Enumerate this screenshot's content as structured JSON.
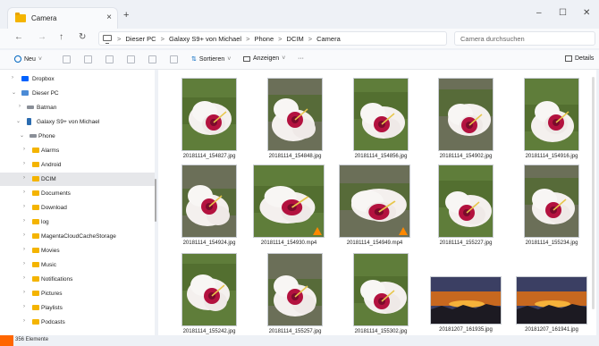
{
  "tab": {
    "title": "Camera",
    "close": "×",
    "new": "+"
  },
  "window": {
    "minimize": "–",
    "maximize": "☐",
    "close": "✕"
  },
  "nav": {
    "back": "←",
    "forward": "→",
    "up": "↑",
    "refresh": "↻",
    "more": "›"
  },
  "breadcrumbs": [
    "Dieser PC",
    "Galaxy S9+ von Michael",
    "Phone",
    "DCIM",
    "Camera"
  ],
  "breadcrumb_sep": ">",
  "search": {
    "placeholder": "Camera durchsuchen"
  },
  "toolbar": {
    "new_label": "Neu",
    "sort_label": "Sortieren",
    "view_label": "Anzeigen",
    "more_label": "···",
    "details_label": "Details"
  },
  "sidebar": {
    "items": [
      {
        "label": "Dropbox",
        "chev": ">",
        "icon": "dropbox-icon"
      },
      {
        "label": "Dieser PC",
        "chev": "v",
        "icon": "pc-icon"
      },
      {
        "label": "Batman",
        "chev": ">",
        "icon": "drive-icon"
      },
      {
        "label": "Galaxy S9+ von Michael",
        "chev": "v",
        "icon": "phone-icon"
      },
      {
        "label": "Phone",
        "chev": "v",
        "icon": "drive-icon"
      },
      {
        "label": "Alarms",
        "chev": ">",
        "icon": "folder-icon"
      },
      {
        "label": "Android",
        "chev": ">",
        "icon": "folder-icon"
      },
      {
        "label": "DCIM",
        "chev": ">",
        "icon": "folder-icon",
        "selected": true
      },
      {
        "label": "Documents",
        "chev": ">",
        "icon": "folder-icon"
      },
      {
        "label": "Download",
        "chev": ">",
        "icon": "folder-icon"
      },
      {
        "label": "log",
        "chev": ">",
        "icon": "folder-icon"
      },
      {
        "label": "MagentaCloudCacheStorage",
        "chev": ">",
        "icon": "folder-icon"
      },
      {
        "label": "Movies",
        "chev": ">",
        "icon": "folder-icon"
      },
      {
        "label": "Music",
        "chev": ">",
        "icon": "folder-icon"
      },
      {
        "label": "Notifications",
        "chev": ">",
        "icon": "folder-icon"
      },
      {
        "label": "Pictures",
        "chev": ">",
        "icon": "folder-icon"
      },
      {
        "label": "Playlists",
        "chev": ">",
        "icon": "folder-icon"
      },
      {
        "label": "Podcasts",
        "chev": ">",
        "icon": "folder-icon"
      }
    ]
  },
  "files": [
    {
      "name": "20181114_154827.jpg",
      "kind": "flower"
    },
    {
      "name": "20181114_154848.jpg",
      "kind": "flower"
    },
    {
      "name": "20181114_154856.jpg",
      "kind": "flower"
    },
    {
      "name": "20181114_154902.jpg",
      "kind": "flower"
    },
    {
      "name": "20181114_154916.jpg",
      "kind": "flower"
    },
    {
      "name": "20181114_154924.jpg",
      "kind": "flower"
    },
    {
      "name": "20181114_154930.mp4",
      "kind": "video"
    },
    {
      "name": "20181114_154949.mp4",
      "kind": "video"
    },
    {
      "name": "20181114_155227.jpg",
      "kind": "flower"
    },
    {
      "name": "20181114_155234.jpg",
      "kind": "flower"
    },
    {
      "name": "20181114_155242.jpg",
      "kind": "flower"
    },
    {
      "name": "20181114_155257.jpg",
      "kind": "flower"
    },
    {
      "name": "20181114_155302.jpg",
      "kind": "flower"
    },
    {
      "name": "20181207_161935.jpg",
      "kind": "sunset"
    },
    {
      "name": "20181207_161941.jpg",
      "kind": "sunset"
    }
  ],
  "status": {
    "count": "356 Elemente"
  },
  "colors": {
    "accent": "#0067c0",
    "folder": "#f4b400",
    "vlc": "#ff8800"
  }
}
